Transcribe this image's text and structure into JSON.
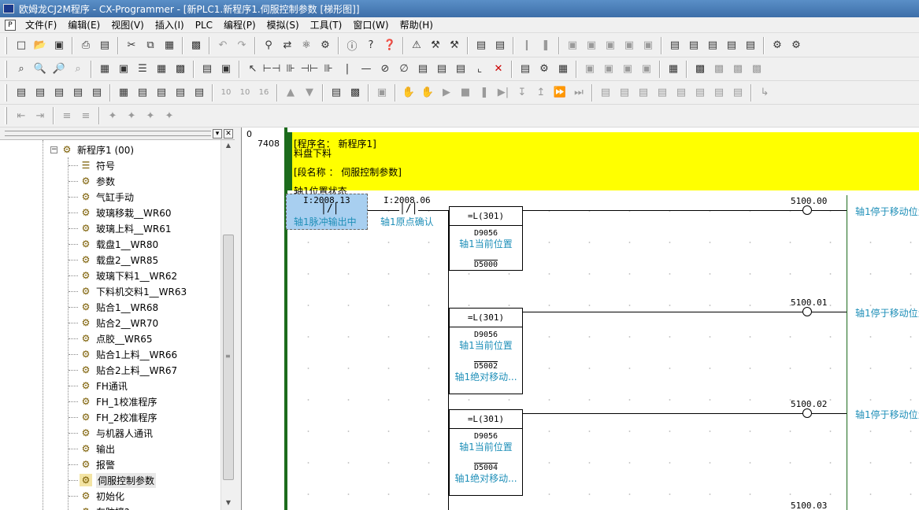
{
  "window": {
    "title": "欧姆龙CJ2M程序 - CX-Programmer - [新PLC1.新程序1.伺服控制参数 [梯形图]]"
  },
  "menu": [
    "文件(F)",
    "编辑(E)",
    "视图(V)",
    "插入(I)",
    "PLC",
    "编程(P)",
    "模拟(S)",
    "工具(T)",
    "窗口(W)",
    "帮助(H)"
  ],
  "tree": {
    "root": "新程序1 (00)",
    "items": [
      "符号",
      "参数",
      "气缸手动",
      "玻璃移栽__WR60",
      "玻璃上料__WR61",
      "载盘1__WR80",
      "载盘2__WR85",
      "玻璃下料1__WR62",
      "下料机交料1__WR63",
      "贴合1__WR68",
      "贴合2__WR70",
      "点胶__WR65",
      "贴合1上料__WR66",
      "贴合2上料__WR67",
      "FH通讯",
      "FH_1校准程序",
      "FH_2校准程序",
      "与机器人通讯",
      "输出",
      "报警",
      "伺服控制参数",
      "初始化",
      "车防撞?"
    ],
    "selected_index": 20
  },
  "ladder": {
    "rung_index": "0",
    "step": "7408",
    "comment": {
      "program_label": "[程序名： 新程序1]",
      "program_desc": "料盘下料",
      "section_label": "[段名称 ： 伺服控制参数]",
      "rung_comment": "轴1位置状态"
    },
    "contact1": {
      "addr": "I:2008.13",
      "comment": "轴1脉冲输出中"
    },
    "contact2": {
      "addr": "I:2008.06",
      "comment": "轴1原点确认"
    },
    "blocks": [
      {
        "instr": "=L(301)",
        "op1": "D9056",
        "op1_comment": "轴1当前位置",
        "op2": "D5000",
        "op2_comment": "",
        "coil_addr": "5100.00",
        "coil_comment": "轴1停于移动位置"
      },
      {
        "instr": "=L(301)",
        "op1": "D9056",
        "op1_comment": "轴1当前位置",
        "op2": "D5002",
        "op2_comment": "轴1绝对移动...",
        "coil_addr": "5100.01",
        "coil_comment": "轴1停于移动位置"
      },
      {
        "instr": "=L(301)",
        "op1": "D9056",
        "op1_comment": "轴1当前位置",
        "op2": "D5004",
        "op2_comment": "轴1绝对移动...",
        "coil_addr": "5100.02",
        "coil_comment": "轴1停于移动位置"
      }
    ],
    "next_coil_addr": "5100.03"
  }
}
